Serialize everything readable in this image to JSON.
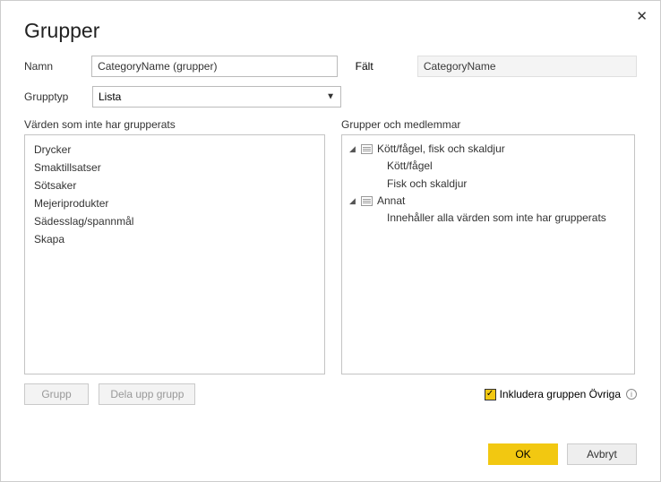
{
  "dialog": {
    "title": "Grupper",
    "name_label": "Namn",
    "name_value": "CategoryName (grupper)",
    "field_label": "Fält",
    "field_value": "CategoryName",
    "grouptype_label": "Grupptyp",
    "grouptype_value": "Lista"
  },
  "left_pane": {
    "title": "Värden som inte har grupperats",
    "items": [
      "Drycker",
      "Smaktillsatser",
      "Sötsaker",
      "Mejeriprodukter",
      "Sädesslag/spannmål",
      "Skapa"
    ]
  },
  "right_pane": {
    "title": "Grupper och medlemmar",
    "groups": [
      {
        "label": "Kött/fågel, fisk och skaldjur",
        "children": [
          "Kött/fågel",
          "Fisk och skaldjur"
        ]
      },
      {
        "label": "Annat",
        "children": [
          "Innehåller alla värden som inte har grupperats"
        ]
      }
    ]
  },
  "buttons": {
    "group": "Grupp",
    "ungroup": "Dela upp grupp",
    "ok": "OK",
    "cancel": "Avbryt"
  },
  "include_other": "Inkludera gruppen Övriga"
}
